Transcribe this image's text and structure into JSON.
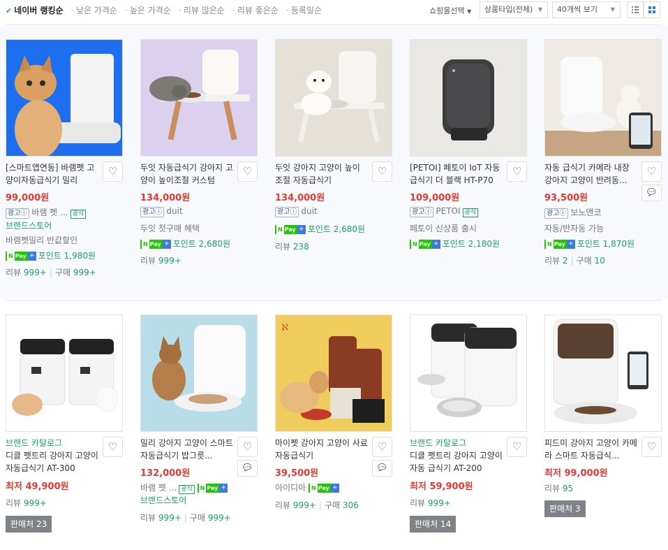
{
  "sort_options": [
    "네이버 랭킹순",
    "낮은 가격순",
    "높은 가격순",
    "리뷰 많은순",
    "리뷰 좋은순",
    "등록일순"
  ],
  "controls": {
    "mall": "쇼핑몰선택",
    "type": "상품타입(전체)",
    "per_page": "40개씩 보기"
  },
  "labels": {
    "ad": "광고ⓘ",
    "official": "공식",
    "npay": "Pay",
    "point": "포인트",
    "review": "리뷰",
    "purchase": "구매",
    "sellers": "판매처",
    "lowest": "최저",
    "brandstore": "브랜드스토어",
    "brand_catalog": "브랜드 카탈로그"
  },
  "colors": {
    "accent": "#e23b32",
    "green": "#1aa260",
    "npay": "#1ec800"
  },
  "products": [
    {
      "title": "[스마트앱연동] 바램펫 고양이자동급식기 밀리",
      "price": "99,000원",
      "seller": "바램 펫 ...",
      "extra": "바램펫밀리 반값할인",
      "point": "포인트 1,980원",
      "review": "999+",
      "purchase": "999+"
    },
    {
      "title": "두잇 자동급식기 강아지 고양이 높이조절 커스텀",
      "price": "134,000원",
      "seller": "duit",
      "extra": "두잇 첫구매 혜택",
      "point": "포인트 2,680원",
      "review": "999+"
    },
    {
      "title": "두잇 강아지 고양이 높이 조절 자동급식기",
      "price": "134,000원",
      "seller": "duit",
      "point": "포인트 2,680원",
      "review": "238"
    },
    {
      "title": "[PETOI] 페토이 IoT 자동 급식기 더 블랙 HT-P70",
      "price": "109,000원",
      "seller": "PETOI",
      "extra": "페토이 신상품 출시",
      "point": "포인트 2,180원"
    },
    {
      "title": "자동 급식기 카메라 내장 강아지 고양이 반려동...",
      "price": "93,500원",
      "seller": "보노앤코",
      "extra": "자동/반자동 가능",
      "point": "포인트 1,870원",
      "review": "2",
      "purchase": "10"
    },
    {
      "title": "디클 펫트리 강아지 고양이 자동급식기 AT-300",
      "price": "49,900원",
      "review": "999+",
      "sellers": "23"
    },
    {
      "title": "밀리 강아지 고양이 스마트 자동급식기 밥그릇...",
      "price": "132,000원",
      "seller": "바램 펫 ...",
      "review": "999+",
      "purchase": "999+"
    },
    {
      "title": "마이펫 강아지 고양이 사료 자동급식기",
      "price": "39,500원",
      "seller": "아이디아",
      "review": "999+",
      "purchase": "306"
    },
    {
      "title": "디클 펫트리 강아지 고양이 자동 급식기 AT-200",
      "price": "59,900원",
      "review": "999+",
      "sellers": "14"
    },
    {
      "title": "피드미 강아지 고양이 카메라 스마트 자동급식...",
      "price": "99,000원",
      "review": "95",
      "sellers": "3"
    }
  ]
}
